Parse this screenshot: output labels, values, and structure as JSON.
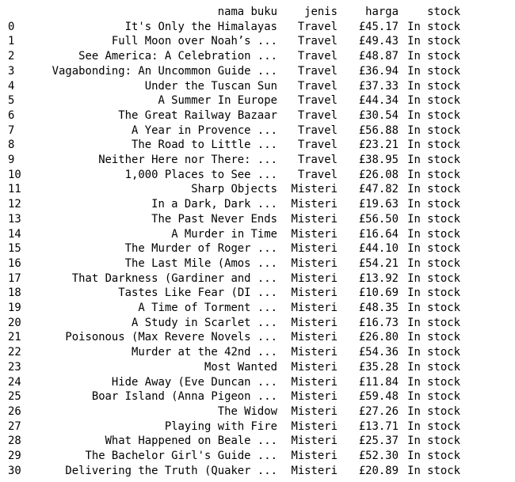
{
  "dataframe": {
    "columns": [
      "nama buku",
      "jenis",
      "harga",
      "stock"
    ],
    "rows": [
      {
        "index": "0",
        "nama_buku": "It's Only the Himalayas",
        "jenis": "Travel",
        "harga": "£45.17",
        "stock": "In stock"
      },
      {
        "index": "1",
        "nama_buku": "Full Moon over Noah’s ...",
        "jenis": "Travel",
        "harga": "£49.43",
        "stock": "In stock"
      },
      {
        "index": "2",
        "nama_buku": "See America: A Celebration ...",
        "jenis": "Travel",
        "harga": "£48.87",
        "stock": "In stock"
      },
      {
        "index": "3",
        "nama_buku": "Vagabonding: An Uncommon Guide ...",
        "jenis": "Travel",
        "harga": "£36.94",
        "stock": "In stock"
      },
      {
        "index": "4",
        "nama_buku": "Under the Tuscan Sun",
        "jenis": "Travel",
        "harga": "£37.33",
        "stock": "In stock"
      },
      {
        "index": "5",
        "nama_buku": "A Summer In Europe",
        "jenis": "Travel",
        "harga": "£44.34",
        "stock": "In stock"
      },
      {
        "index": "6",
        "nama_buku": "The Great Railway Bazaar",
        "jenis": "Travel",
        "harga": "£30.54",
        "stock": "In stock"
      },
      {
        "index": "7",
        "nama_buku": "A Year in Provence ...",
        "jenis": "Travel",
        "harga": "£56.88",
        "stock": "In stock"
      },
      {
        "index": "8",
        "nama_buku": "The Road to Little ...",
        "jenis": "Travel",
        "harga": "£23.21",
        "stock": "In stock"
      },
      {
        "index": "9",
        "nama_buku": "Neither Here nor There: ...",
        "jenis": "Travel",
        "harga": "£38.95",
        "stock": "In stock"
      },
      {
        "index": "10",
        "nama_buku": "1,000 Places to See ...",
        "jenis": "Travel",
        "harga": "£26.08",
        "stock": "In stock"
      },
      {
        "index": "11",
        "nama_buku": "Sharp Objects",
        "jenis": "Misteri",
        "harga": "£47.82",
        "stock": "In stock"
      },
      {
        "index": "12",
        "nama_buku": "In a Dark, Dark ...",
        "jenis": "Misteri",
        "harga": "£19.63",
        "stock": "In stock"
      },
      {
        "index": "13",
        "nama_buku": "The Past Never Ends",
        "jenis": "Misteri",
        "harga": "£56.50",
        "stock": "In stock"
      },
      {
        "index": "14",
        "nama_buku": "A Murder in Time",
        "jenis": "Misteri",
        "harga": "£16.64",
        "stock": "In stock"
      },
      {
        "index": "15",
        "nama_buku": "The Murder of Roger ...",
        "jenis": "Misteri",
        "harga": "£44.10",
        "stock": "In stock"
      },
      {
        "index": "16",
        "nama_buku": "The Last Mile (Amos ...",
        "jenis": "Misteri",
        "harga": "£54.21",
        "stock": "In stock"
      },
      {
        "index": "17",
        "nama_buku": "That Darkness (Gardiner and ...",
        "jenis": "Misteri",
        "harga": "£13.92",
        "stock": "In stock"
      },
      {
        "index": "18",
        "nama_buku": "Tastes Like Fear (DI ...",
        "jenis": "Misteri",
        "harga": "£10.69",
        "stock": "In stock"
      },
      {
        "index": "19",
        "nama_buku": "A Time of Torment ...",
        "jenis": "Misteri",
        "harga": "£48.35",
        "stock": "In stock"
      },
      {
        "index": "20",
        "nama_buku": "A Study in Scarlet ...",
        "jenis": "Misteri",
        "harga": "£16.73",
        "stock": "In stock"
      },
      {
        "index": "21",
        "nama_buku": "Poisonous (Max Revere Novels ...",
        "jenis": "Misteri",
        "harga": "£26.80",
        "stock": "In stock"
      },
      {
        "index": "22",
        "nama_buku": "Murder at the 42nd ...",
        "jenis": "Misteri",
        "harga": "£54.36",
        "stock": "In stock"
      },
      {
        "index": "23",
        "nama_buku": "Most Wanted",
        "jenis": "Misteri",
        "harga": "£35.28",
        "stock": "In stock"
      },
      {
        "index": "24",
        "nama_buku": "Hide Away (Eve Duncan ...",
        "jenis": "Misteri",
        "harga": "£11.84",
        "stock": "In stock"
      },
      {
        "index": "25",
        "nama_buku": "Boar Island (Anna Pigeon ...",
        "jenis": "Misteri",
        "harga": "£59.48",
        "stock": "In stock"
      },
      {
        "index": "26",
        "nama_buku": "The Widow",
        "jenis": "Misteri",
        "harga": "£27.26",
        "stock": "In stock"
      },
      {
        "index": "27",
        "nama_buku": "Playing with Fire",
        "jenis": "Misteri",
        "harga": "£13.71",
        "stock": "In stock"
      },
      {
        "index": "28",
        "nama_buku": "What Happened on Beale ...",
        "jenis": "Misteri",
        "harga": "£25.37",
        "stock": "In stock"
      },
      {
        "index": "29",
        "nama_buku": "The Bachelor Girl's Guide ...",
        "jenis": "Misteri",
        "harga": "£52.30",
        "stock": "In stock"
      },
      {
        "index": "30",
        "nama_buku": "Delivering the Truth (Quaker ...",
        "jenis": "Misteri",
        "harga": "£20.89",
        "stock": "In stock"
      }
    ]
  }
}
